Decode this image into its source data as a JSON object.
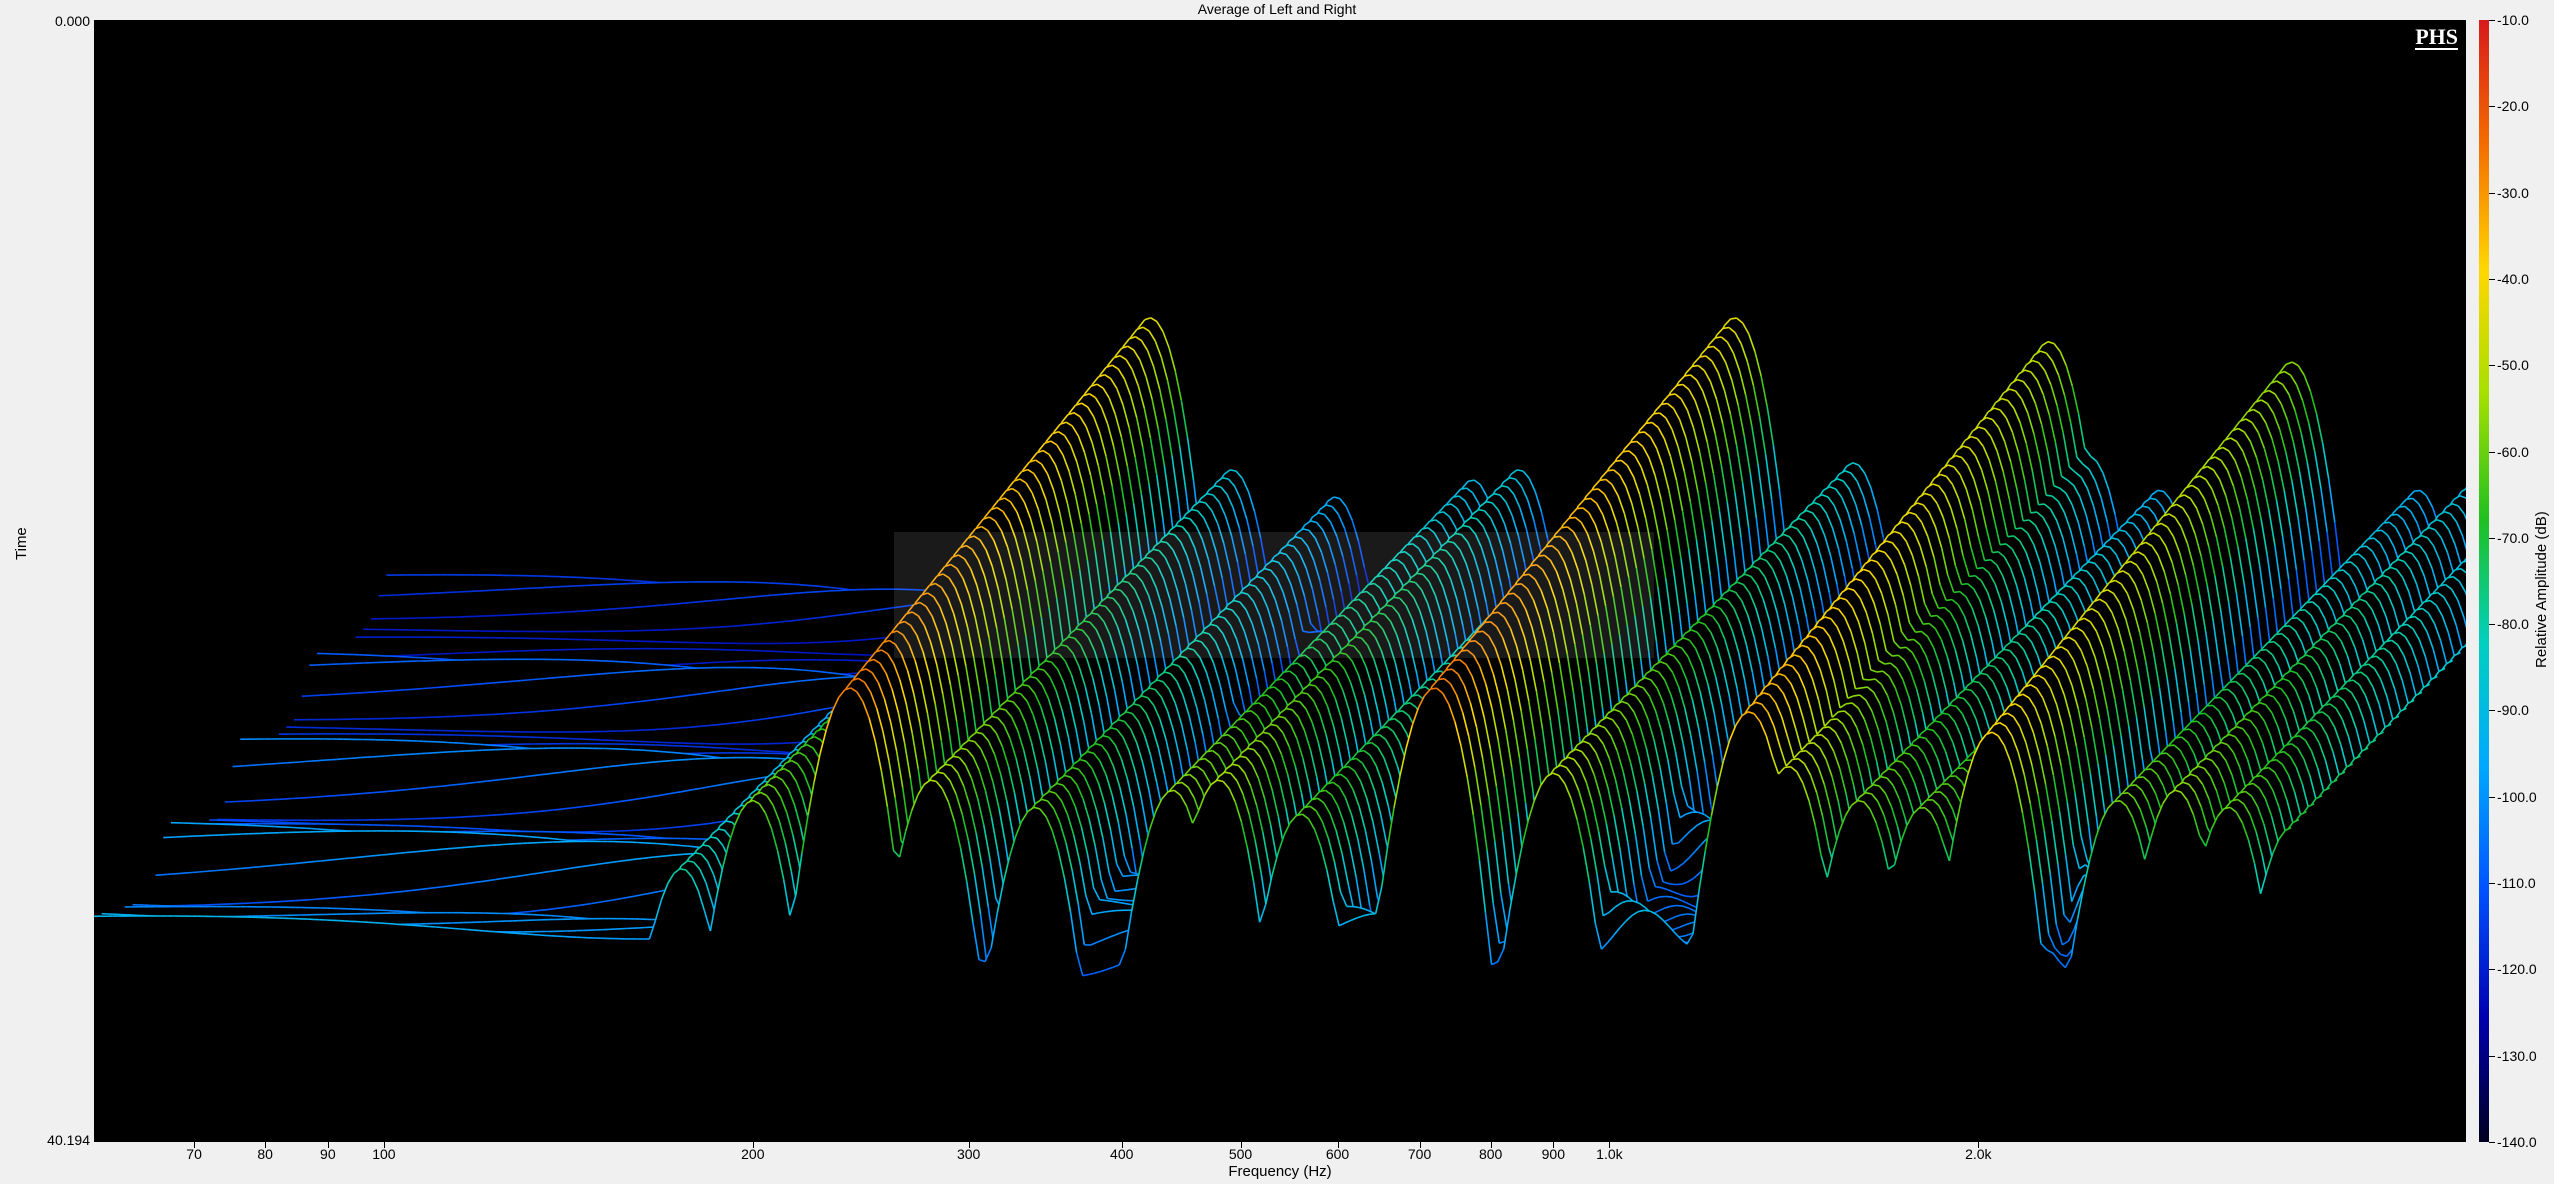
{
  "chart_data": {
    "type": "waterfall",
    "title": "Average of Left and Right",
    "xlabel": "Frequency (Hz)",
    "ylabel": "Time",
    "xscale": "log",
    "xlim": [
      58,
      5000
    ],
    "ylim": [
      0.0,
      40.194
    ],
    "y_tick_labels": [
      "0.000",
      "40.194"
    ],
    "x_ticks": [
      {
        "value": 70,
        "label": "70"
      },
      {
        "value": 80,
        "label": "80"
      },
      {
        "value": 90,
        "label": "90"
      },
      {
        "value": 100,
        "label": "100"
      },
      {
        "value": 200,
        "label": "200"
      },
      {
        "value": 300,
        "label": "300"
      },
      {
        "value": 400,
        "label": "400"
      },
      {
        "value": 500,
        "label": "500"
      },
      {
        "value": 600,
        "label": "600"
      },
      {
        "value": 700,
        "label": "700"
      },
      {
        "value": 800,
        "label": "800"
      },
      {
        "value": 900,
        "label": "900"
      },
      {
        "value": 1000,
        "label": "1.0k"
      },
      {
        "value": 2000,
        "label": "2.0k"
      }
    ],
    "colorbar": {
      "label": "Relative Amplitude (dB)",
      "range": [
        -140.0,
        -10.0
      ],
      "ticks": [
        "-10.0",
        "-20.0",
        "-30.0",
        "-40.0",
        "-50.0",
        "-60.0",
        "-70.0",
        "-80.0",
        "-90.0",
        "-100.0",
        "-110.0",
        "-120.0",
        "-130.0",
        "-140.0"
      ],
      "colors": [
        "#d7191c",
        "#f46d00",
        "#ffd700",
        "#a6e000",
        "#20c020",
        "#00d0c0",
        "#00a8ff",
        "#0050ff",
        "#0000b0",
        "#000020"
      ]
    },
    "peaks": [
      {
        "freq": 175,
        "level": -78
      },
      {
        "freq": 200,
        "level": -58
      },
      {
        "freq": 240,
        "level": -25
      },
      {
        "freq": 280,
        "level": -52
      },
      {
        "freq": 340,
        "level": -60
      },
      {
        "freq": 440,
        "level": -55
      },
      {
        "freq": 480,
        "level": -52
      },
      {
        "freq": 560,
        "level": -62
      },
      {
        "freq": 720,
        "level": -25
      },
      {
        "freq": 900,
        "level": -50
      },
      {
        "freq": 1300,
        "level": -32
      },
      {
        "freq": 1400,
        "level": -48
      },
      {
        "freq": 1600,
        "level": -58
      },
      {
        "freq": 1800,
        "level": -60
      },
      {
        "freq": 2050,
        "level": -38
      },
      {
        "freq": 2600,
        "level": -58
      },
      {
        "freq": 2900,
        "level": -55
      },
      {
        "freq": 3200,
        "level": -60
      },
      {
        "freq": 3600,
        "level": -66
      },
      {
        "freq": 4200,
        "level": -70
      }
    ]
  },
  "watermark_brand": "PHS"
}
